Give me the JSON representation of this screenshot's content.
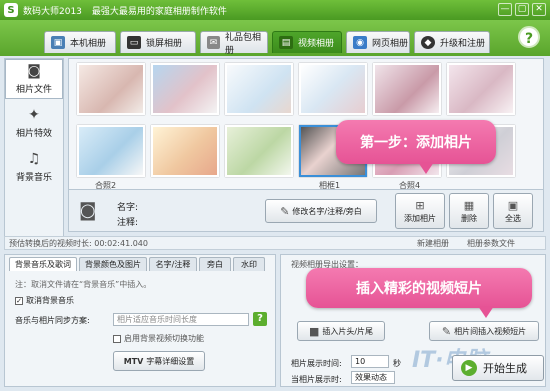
{
  "titlebar": {
    "logo": "S",
    "app_title": "数码大师2013",
    "slogan": "最强大最易用的家庭相册制作软件",
    "window_buttons": [
      "—",
      "▢",
      "✕"
    ]
  },
  "tabs": [
    {
      "label": "本机相册",
      "icon": "pc-icon",
      "active": false
    },
    {
      "label": "锁屏相册",
      "icon": "monitor-icon",
      "active": false
    },
    {
      "label": "礼品包相册",
      "icon": "gift-icon",
      "active": false
    },
    {
      "label": "视频相册",
      "icon": "film-icon",
      "active": true
    },
    {
      "label": "网页相册",
      "icon": "web-icon",
      "active": false
    },
    {
      "label": "升级和注册",
      "icon": "upgrade-icon",
      "active": false
    }
  ],
  "help_label": "?",
  "sidebar": [
    {
      "label": "相片文件",
      "icon": "camera-icon",
      "active": true
    },
    {
      "label": "相片特效",
      "icon": "sparkle-icon",
      "active": false
    },
    {
      "label": "背景音乐",
      "icon": "music-icon",
      "active": false
    }
  ],
  "photo_captions": {
    "row2_left": "合照2",
    "row2_mid": "相框1",
    "row2_right": "合照4"
  },
  "info": {
    "name_label": "名字:",
    "note_label": "注释:",
    "edit_btn": "修改名字/注释/旁白",
    "add_btn": "添加相片",
    "delete_btn": "删除",
    "select_all_btn": "全选"
  },
  "status": {
    "estimate": "预估转换后的视频时长:  00:02:41.040",
    "new_album": "新建相册",
    "album_params": "相册参数文件"
  },
  "bottom_tabs": [
    "背景音乐及歌词",
    "背景颜色及图片",
    "名字/注释",
    "旁白",
    "水印"
  ],
  "bottom_left": {
    "note": "注：取消文件请在“背景音乐”中插入。",
    "cancel_music": "取消背景音乐",
    "sync_label": "音乐与相片同步方案:",
    "sync_value": "相片适应音乐时间长度",
    "enable_switch": "启用背景视频切换功能",
    "mtv_btn_prefix": "MTV",
    "mtv_btn": "字幕详细设置"
  },
  "bottom_right": {
    "header": "视频相册导出设置：",
    "insert_title_btn": "插入片头/片尾",
    "insert_clip_btn": "相片间插入视频短片",
    "display_time_label": "相片展示时间:",
    "display_time_value": "10",
    "display_time_unit": "秒",
    "effect_label": "当相片展示时:",
    "effect_value": "效果动态",
    "start_btn": "开始生成"
  },
  "callouts": {
    "step1": "第一步：添加相片",
    "clip": "插入精彩的视频短片"
  },
  "watermark": "IT·电脑"
}
